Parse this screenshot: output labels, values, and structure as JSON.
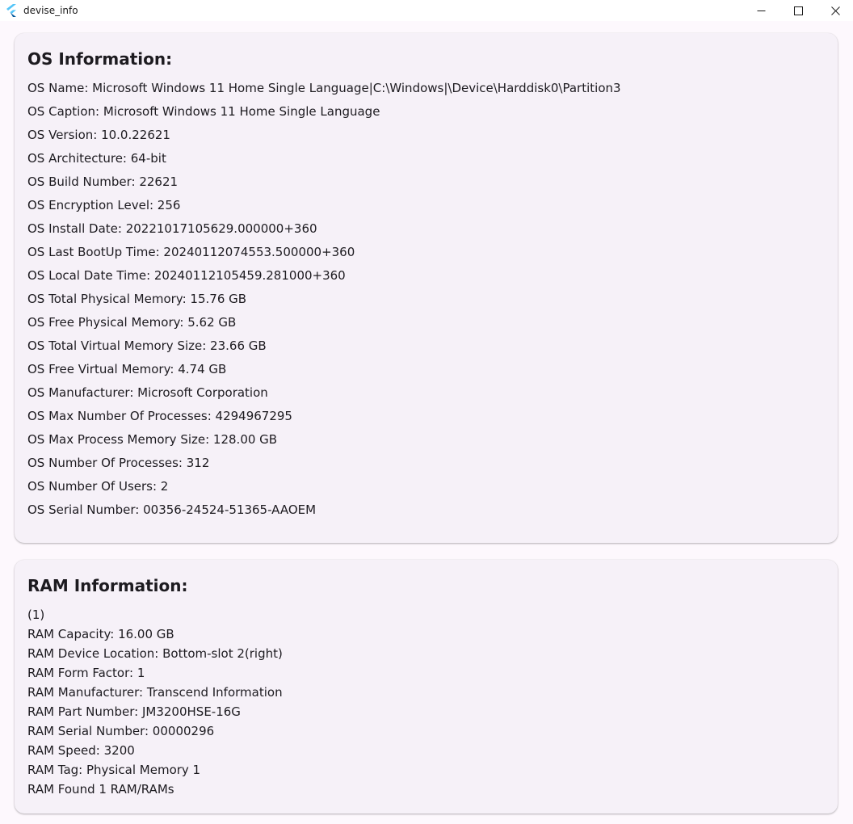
{
  "window": {
    "title": "devise_info",
    "controls": {
      "minimize": "minimize-icon",
      "maximize": "maximize-icon",
      "close": "close-icon"
    }
  },
  "os_section": {
    "title": "OS Information:",
    "lines": [
      "OS Name: Microsoft Windows 11 Home Single Language|C:\\Windows|\\Device\\Harddisk0\\Partition3",
      "OS Caption: Microsoft Windows 11 Home Single Language",
      "OS Version: 10.0.22621",
      "OS Architecture: 64-bit",
      "OS Build Number: 22621",
      "OS Encryption Level: 256",
      "OS Install Date: 20221017105629.000000+360",
      "OS Last BootUp Time: 20240112074553.500000+360",
      "OS Local Date Time: 20240112105459.281000+360",
      "OS Total Physical Memory: 15.76 GB",
      "OS Free Physical Memory: 5.62 GB",
      "OS Total Virtual Memory Size: 23.66 GB",
      "OS Free Virtual Memory: 4.74 GB",
      "OS Manufacturer: Microsoft Corporation",
      "OS Max Number Of Processes: 4294967295",
      "OS Max Process Memory Size: 128.00 GB",
      "OS Number Of Processes: 312",
      "OS Number Of Users: 2",
      "OS Serial Number: 00356-24524-51365-AAOEM"
    ]
  },
  "ram_section": {
    "title": "RAM Information:",
    "lines": [
      "(1)",
      "RAM Capacity: 16.00 GB",
      "RAM Device Location: Bottom-slot 2(right)",
      "RAM Form Factor: 1",
      "RAM Manufacturer: Transcend Information",
      "RAM Part Number: JM3200HSE-16G",
      "RAM Serial Number: 00000296",
      "RAM Speed: 3200",
      "RAM Tag: Physical Memory 1",
      "RAM Found 1 RAM/RAMs"
    ]
  },
  "colors": {
    "page_background": "#fdf8fd",
    "card_background": "#f6f1f8",
    "text": "#1d1b20",
    "flutter_logo_light": "#54c5f8",
    "flutter_logo_dark": "#01579b"
  }
}
